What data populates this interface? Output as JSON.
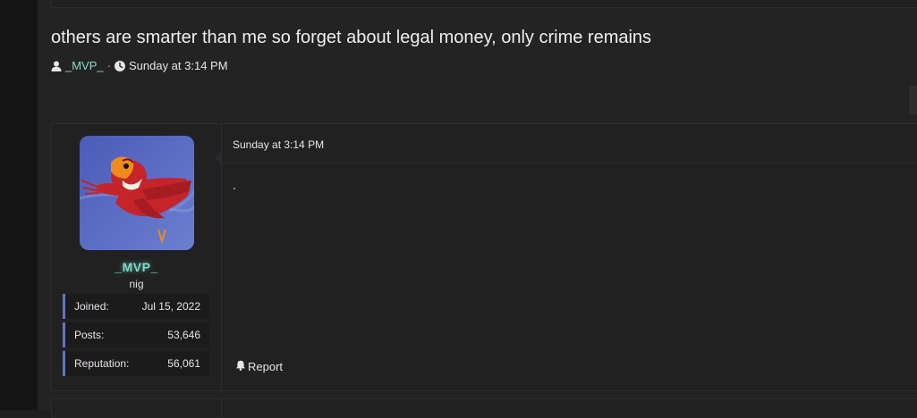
{
  "thread": {
    "title": "others are smarter than me so forget about legal money, only crime remains",
    "author": "_MVP_",
    "separator": "·",
    "date": "Sunday at 3:14 PM"
  },
  "post": {
    "username": "_MVP_",
    "user_title": "nig",
    "stats": [
      {
        "label": "Joined:",
        "value": "Jul 15, 2022"
      },
      {
        "label": "Posts:",
        "value": "53,646"
      },
      {
        "label": "Reputation:",
        "value": "56,061"
      }
    ],
    "date": "Sunday at 3:14 PM",
    "body": ".",
    "report_label": "Report"
  },
  "icons": {
    "author": "user-icon",
    "date": "clock-icon",
    "report": "bell-icon",
    "avatar": "parrot-avatar"
  },
  "colors": {
    "username": "#7fd8c6",
    "stat_accent": "#6275c7",
    "background": "#232323"
  }
}
